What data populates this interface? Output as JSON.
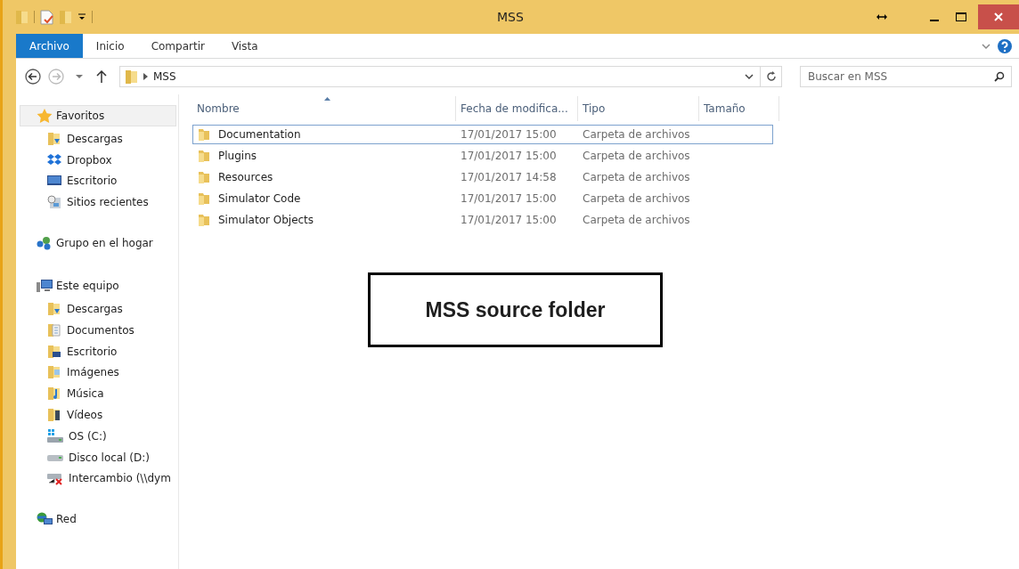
{
  "window": {
    "title": "MSS"
  },
  "ribbon_tabs": [
    {
      "label": "Archivo",
      "selected": true
    },
    {
      "label": "Inicio",
      "selected": false
    },
    {
      "label": "Compartir",
      "selected": false
    },
    {
      "label": "Vista",
      "selected": false
    }
  ],
  "address_bar": {
    "path": [
      "MSS"
    ]
  },
  "search": {
    "placeholder": "Buscar en MSS"
  },
  "sidebar": {
    "groups": [
      {
        "label": "Favoritos",
        "kind": "star",
        "selected": true,
        "children": [
          {
            "label": "Descargas",
            "kind": "downloads",
            "selected": false
          },
          {
            "label": "Dropbox",
            "kind": "dropbox",
            "selected": false
          },
          {
            "label": "Escritorio",
            "kind": "desktop",
            "selected": false
          },
          {
            "label": "Sitios recientes",
            "kind": "recent",
            "selected": false
          }
        ]
      },
      {
        "label": "Grupo en el hogar",
        "kind": "homegroup",
        "selected": false
      },
      {
        "label": "Este equipo",
        "kind": "computer",
        "selected": false,
        "children": [
          {
            "label": "Descargas",
            "kind": "downloads",
            "selected": false
          },
          {
            "label": "Documentos",
            "kind": "documents",
            "selected": false
          },
          {
            "label": "Escritorio",
            "kind": "desktop-folder",
            "selected": false
          },
          {
            "label": "Imágenes",
            "kind": "pictures",
            "selected": false
          },
          {
            "label": "Música",
            "kind": "music",
            "selected": false
          },
          {
            "label": "Vídeos",
            "kind": "videos",
            "selected": false
          },
          {
            "label": "OS (C:)",
            "kind": "os-drive",
            "selected": false
          },
          {
            "label": "Disco local (D:)",
            "kind": "drive",
            "selected": false
          },
          {
            "label": "Intercambio (\\\\dym",
            "kind": "network-drive",
            "selected": false
          }
        ]
      },
      {
        "label": "Red",
        "kind": "network",
        "selected": false
      }
    ]
  },
  "table": {
    "columns": [
      {
        "label": "Nombre",
        "sorted": true
      },
      {
        "label": "Fecha de modifica...",
        "sorted": false
      },
      {
        "label": "Tipo",
        "sorted": false
      },
      {
        "label": "Tamaño",
        "sorted": false
      }
    ],
    "rows": [
      {
        "name": "Documentation",
        "date": "17/01/2017 15:00",
        "type": "Carpeta de archivos",
        "selected": true
      },
      {
        "name": "Plugins",
        "date": "17/01/2017 15:00",
        "type": "Carpeta de archivos",
        "selected": false
      },
      {
        "name": "Resources",
        "date": "17/01/2017 14:58",
        "type": "Carpeta de archivos",
        "selected": false
      },
      {
        "name": "Simulator Code",
        "date": "17/01/2017 15:00",
        "type": "Carpeta de archivos",
        "selected": false
      },
      {
        "name": "Simulator Objects",
        "date": "17/01/2017 15:00",
        "type": "Carpeta de archivos",
        "selected": false
      }
    ]
  },
  "annotation": {
    "text": "MSS source folder"
  }
}
